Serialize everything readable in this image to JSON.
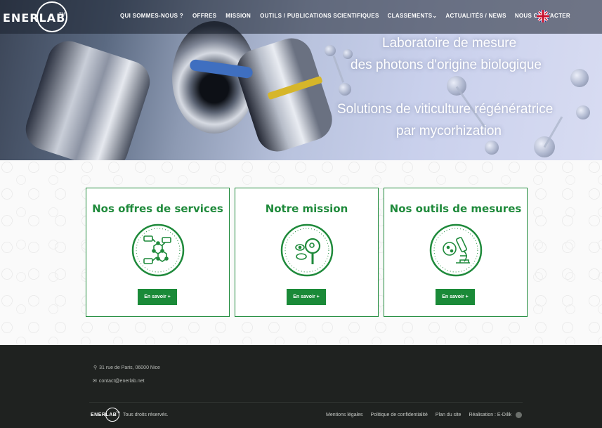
{
  "nav": {
    "logo_text": "ENERLAB",
    "logo_tm": "TM",
    "items": [
      {
        "label": "QUI SOMMES-NOUS ?"
      },
      {
        "label": "OFFRES"
      },
      {
        "label": "MISSION"
      },
      {
        "label": "OUTILS / PUBLICATIONS SCIENTIFIQUES"
      },
      {
        "label": "CLASSEMENTS⌄"
      },
      {
        "label": "ACTUALITÉS / NEWS"
      },
      {
        "label": "NOUS CONTACTER"
      }
    ],
    "flag_icon": "uk-flag-icon"
  },
  "hero": {
    "line1": "Laboratoire de mesure",
    "line2": "des photons d'origine biologique",
    "line3": "Solutions de viticulture régénératrice",
    "line4": "par mycorhization"
  },
  "cards": [
    {
      "title": "Nos offres de services",
      "button": "En savoir +",
      "icon": "molecule-network-icon"
    },
    {
      "title": "Notre mission",
      "button": "En savoir +",
      "icon": "magnifier-cell-icon"
    },
    {
      "title": "Nos outils de mesures",
      "button": "En savoir +",
      "icon": "microscope-icon"
    }
  ],
  "footer": {
    "address": "31 rue de Paris, 06000 Nice",
    "email": "contact@enerlab.net",
    "logo_text": "ENERLAB",
    "logo_tm": "TM",
    "rights": "Tous droits réservés.",
    "links": [
      {
        "label": "Mentions légales"
      },
      {
        "label": "Politique de confidentialité"
      },
      {
        "label": "Plan du site"
      },
      {
        "label": "Réalisation : E-Dilik"
      }
    ]
  },
  "colors": {
    "brand_green": "#1f8a3b",
    "footer_bg": "#1f2220"
  }
}
